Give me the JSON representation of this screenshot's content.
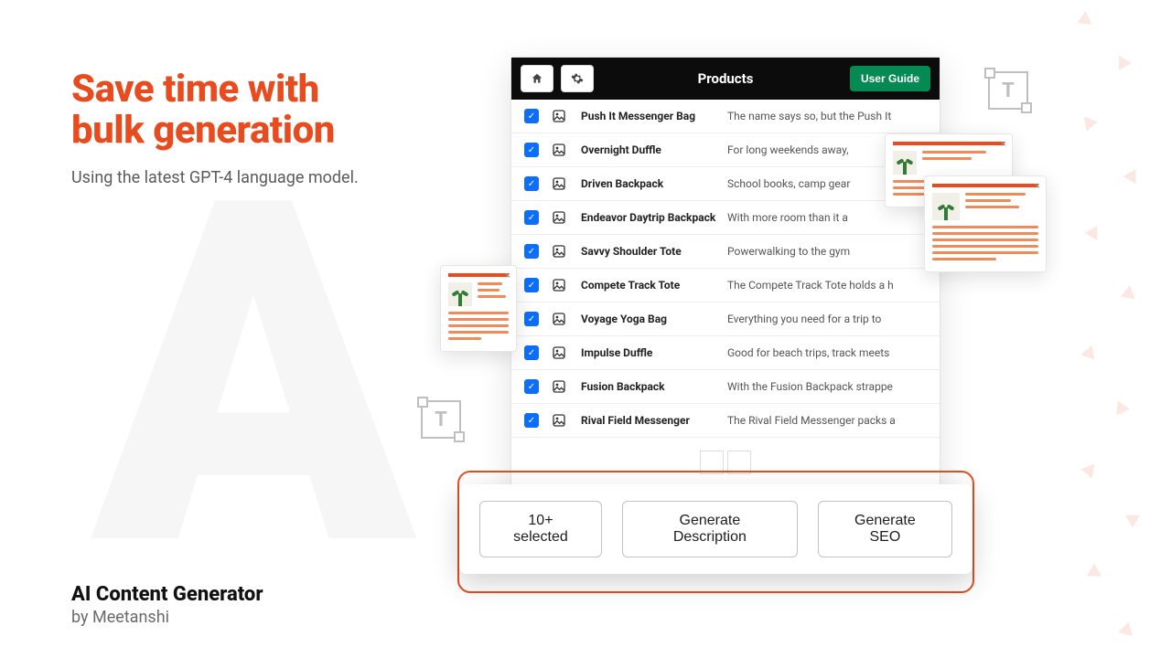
{
  "hero": {
    "title_line1": "Save time with",
    "title_line2": "bulk generation",
    "subtitle": "Using the latest GPT-4 language model."
  },
  "brand": {
    "name": "AI Content Generator",
    "byline": "by Meetanshi"
  },
  "panel": {
    "title": "Products",
    "guide_label": "User Guide"
  },
  "products": [
    {
      "name": "Push It Messenger Bag",
      "desc": "The name says so, but the Push It"
    },
    {
      "name": "Overnight Duffle",
      "desc": "For long weekends away,"
    },
    {
      "name": "Driven Backpack",
      "desc": "School books, camp gear"
    },
    {
      "name": "Endeavor Daytrip Backpack",
      "desc": "With more room than it a"
    },
    {
      "name": "Savvy Shoulder Tote",
      "desc": "Powerwalking to the gym"
    },
    {
      "name": "Compete Track Tote",
      "desc": "The Compete Track Tote holds a h"
    },
    {
      "name": "Voyage Yoga Bag",
      "desc": "Everything you need for a trip to"
    },
    {
      "name": "Impulse Duffle",
      "desc": "Good for beach trips, track meets"
    },
    {
      "name": "Fusion Backpack",
      "desc": "With the Fusion Backpack strappe"
    },
    {
      "name": "Rival Field Messenger",
      "desc": "The Rival Field Messenger packs a"
    }
  ],
  "actions": {
    "selected": "10+ selected",
    "gen_desc": "Generate Description",
    "gen_seo": "Generate SEO"
  },
  "colors": {
    "accent": "#e84c1e",
    "primary_blue": "#0d6efd",
    "guide_green": "#068a53"
  }
}
